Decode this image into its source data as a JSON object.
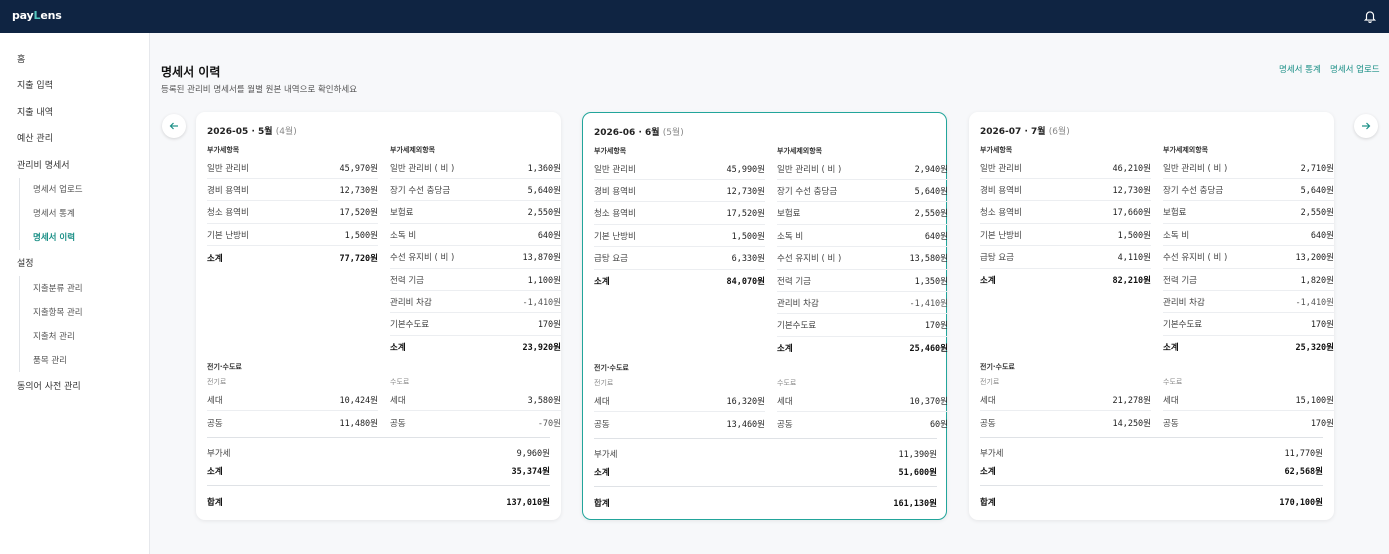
{
  "header": {
    "logo_prefix": "pay",
    "logo_accent": "L",
    "logo_suffix": "ens"
  },
  "sidebar": {
    "items": [
      {
        "label": "홈"
      },
      {
        "label": "지출 입력"
      },
      {
        "label": "지출 내역"
      },
      {
        "label": "예산 관리"
      },
      {
        "label": "관리비 명세서"
      },
      {
        "label": "설정"
      },
      {
        "label": "동의어 사전 관리"
      }
    ],
    "bills_sub": [
      {
        "label": "명세서 업로드"
      },
      {
        "label": "명세서 통계"
      },
      {
        "label": "명세서 이력"
      }
    ],
    "settings_sub": [
      {
        "label": "지출분류 관리"
      },
      {
        "label": "지출항목 관리"
      },
      {
        "label": "지출처 관리"
      },
      {
        "label": "품목 관리"
      }
    ]
  },
  "page": {
    "title": "명세서 이력",
    "subtitle": "등록된 관리비 명세서를 월별 원본 내역으로 확인하세요",
    "link_stats": "명세서 통계",
    "link_upload": "명세서 업로드"
  },
  "labels": {
    "vat_items": "부가세항목",
    "vat_excluded_items": "부가세제외항목",
    "utility": "전기·수도료",
    "electricity": "전기료",
    "water": "수도료"
  },
  "cards": [
    {
      "date": "2026-05 · 5월",
      "month_note": "(4월)",
      "vat": [
        {
          "k": "일반 관리비",
          "v": "45,970원"
        },
        {
          "k": "경비 용역비",
          "v": "12,730원"
        },
        {
          "k": "청소 용역비",
          "v": "17,520원"
        },
        {
          "k": "기본 난방비",
          "v": "1,500원"
        }
      ],
      "vat_total": {
        "k": "소계",
        "v": "77,720원"
      },
      "nonvat": [
        {
          "k": "일반 관리비 ( 비 )",
          "v": "1,360원"
        },
        {
          "k": "장기 수선 충당금",
          "v": "5,640원"
        },
        {
          "k": "보험료",
          "v": "2,550원"
        },
        {
          "k": "소독 비",
          "v": "640원"
        },
        {
          "k": "수선 유지비 ( 비 )",
          "v": "13,870원"
        },
        {
          "k": "전력 기금",
          "v": "1,100원"
        },
        {
          "k": "관리비 차감",
          "v": "-1,410원"
        },
        {
          "k": "기본수도료",
          "v": "170원"
        }
      ],
      "nonvat_total": {
        "k": "소계",
        "v": "23,920원"
      },
      "elec": [
        {
          "k": "세대",
          "v": "10,424원"
        },
        {
          "k": "공동",
          "v": "11,480원"
        }
      ],
      "water": [
        {
          "k": "세대",
          "v": "3,580원"
        },
        {
          "k": "공동",
          "v": "-70원"
        }
      ],
      "tax": {
        "k": "부가세",
        "v": "9,960원"
      },
      "subtotal": {
        "k": "소계",
        "v": "35,374원"
      },
      "grand": {
        "k": "합계",
        "v": "137,010원"
      }
    },
    {
      "date": "2026-06 · 6월",
      "month_note": "(5월)",
      "vat": [
        {
          "k": "일반 관리비",
          "v": "45,990원"
        },
        {
          "k": "경비 용역비",
          "v": "12,730원"
        },
        {
          "k": "청소 용역비",
          "v": "17,520원"
        },
        {
          "k": "기본 난방비",
          "v": "1,500원"
        },
        {
          "k": "급탕 요금",
          "v": "6,330원"
        }
      ],
      "vat_total": {
        "k": "소계",
        "v": "84,070원"
      },
      "nonvat": [
        {
          "k": "일반 관리비 ( 비 )",
          "v": "2,940원"
        },
        {
          "k": "장기 수선 충당금",
          "v": "5,640원"
        },
        {
          "k": "보험료",
          "v": "2,550원"
        },
        {
          "k": "소독 비",
          "v": "640원"
        },
        {
          "k": "수선 유지비 ( 비 )",
          "v": "13,580원"
        },
        {
          "k": "전력 기금",
          "v": "1,350원"
        },
        {
          "k": "관리비 차감",
          "v": "-1,410원"
        },
        {
          "k": "기본수도료",
          "v": "170원"
        }
      ],
      "nonvat_total": {
        "k": "소계",
        "v": "25,460원"
      },
      "elec": [
        {
          "k": "세대",
          "v": "16,320원"
        },
        {
          "k": "공동",
          "v": "13,460원"
        }
      ],
      "water": [
        {
          "k": "세대",
          "v": "10,370원"
        },
        {
          "k": "공동",
          "v": "60원"
        }
      ],
      "tax": {
        "k": "부가세",
        "v": "11,390원"
      },
      "subtotal": {
        "k": "소계",
        "v": "51,600원"
      },
      "grand": {
        "k": "합계",
        "v": "161,130원"
      }
    },
    {
      "date": "2026-07 · 7월",
      "month_note": "(6월)",
      "vat": [
        {
          "k": "일반 관리비",
          "v": "46,210원"
        },
        {
          "k": "경비 용역비",
          "v": "12,730원"
        },
        {
          "k": "청소 용역비",
          "v": "17,660원"
        },
        {
          "k": "기본 난방비",
          "v": "1,500원"
        },
        {
          "k": "급탕 요금",
          "v": "4,110원"
        }
      ],
      "vat_total": {
        "k": "소계",
        "v": "82,210원"
      },
      "nonvat": [
        {
          "k": "일반 관리비 ( 비 )",
          "v": "2,710원"
        },
        {
          "k": "장기 수선 충당금",
          "v": "5,640원"
        },
        {
          "k": "보험료",
          "v": "2,550원"
        },
        {
          "k": "소독 비",
          "v": "640원"
        },
        {
          "k": "수선 유지비 ( 비 )",
          "v": "13,200원"
        },
        {
          "k": "전력 기금",
          "v": "1,820원"
        },
        {
          "k": "관리비 차감",
          "v": "-1,410원"
        },
        {
          "k": "기본수도료",
          "v": "170원"
        }
      ],
      "nonvat_total": {
        "k": "소계",
        "v": "25,320원"
      },
      "elec": [
        {
          "k": "세대",
          "v": "21,278원"
        },
        {
          "k": "공동",
          "v": "14,250원"
        }
      ],
      "water": [
        {
          "k": "세대",
          "v": "15,100원"
        },
        {
          "k": "공동",
          "v": "170원"
        }
      ],
      "tax": {
        "k": "부가세",
        "v": "11,770원"
      },
      "subtotal": {
        "k": "소계",
        "v": "62,568원"
      },
      "grand": {
        "k": "합계",
        "v": "170,100원"
      }
    }
  ],
  "selected_card": 1,
  "colors": {
    "topbar": "#0f2442",
    "accent": "#1a8f86",
    "selected_border": "#22a59b"
  }
}
